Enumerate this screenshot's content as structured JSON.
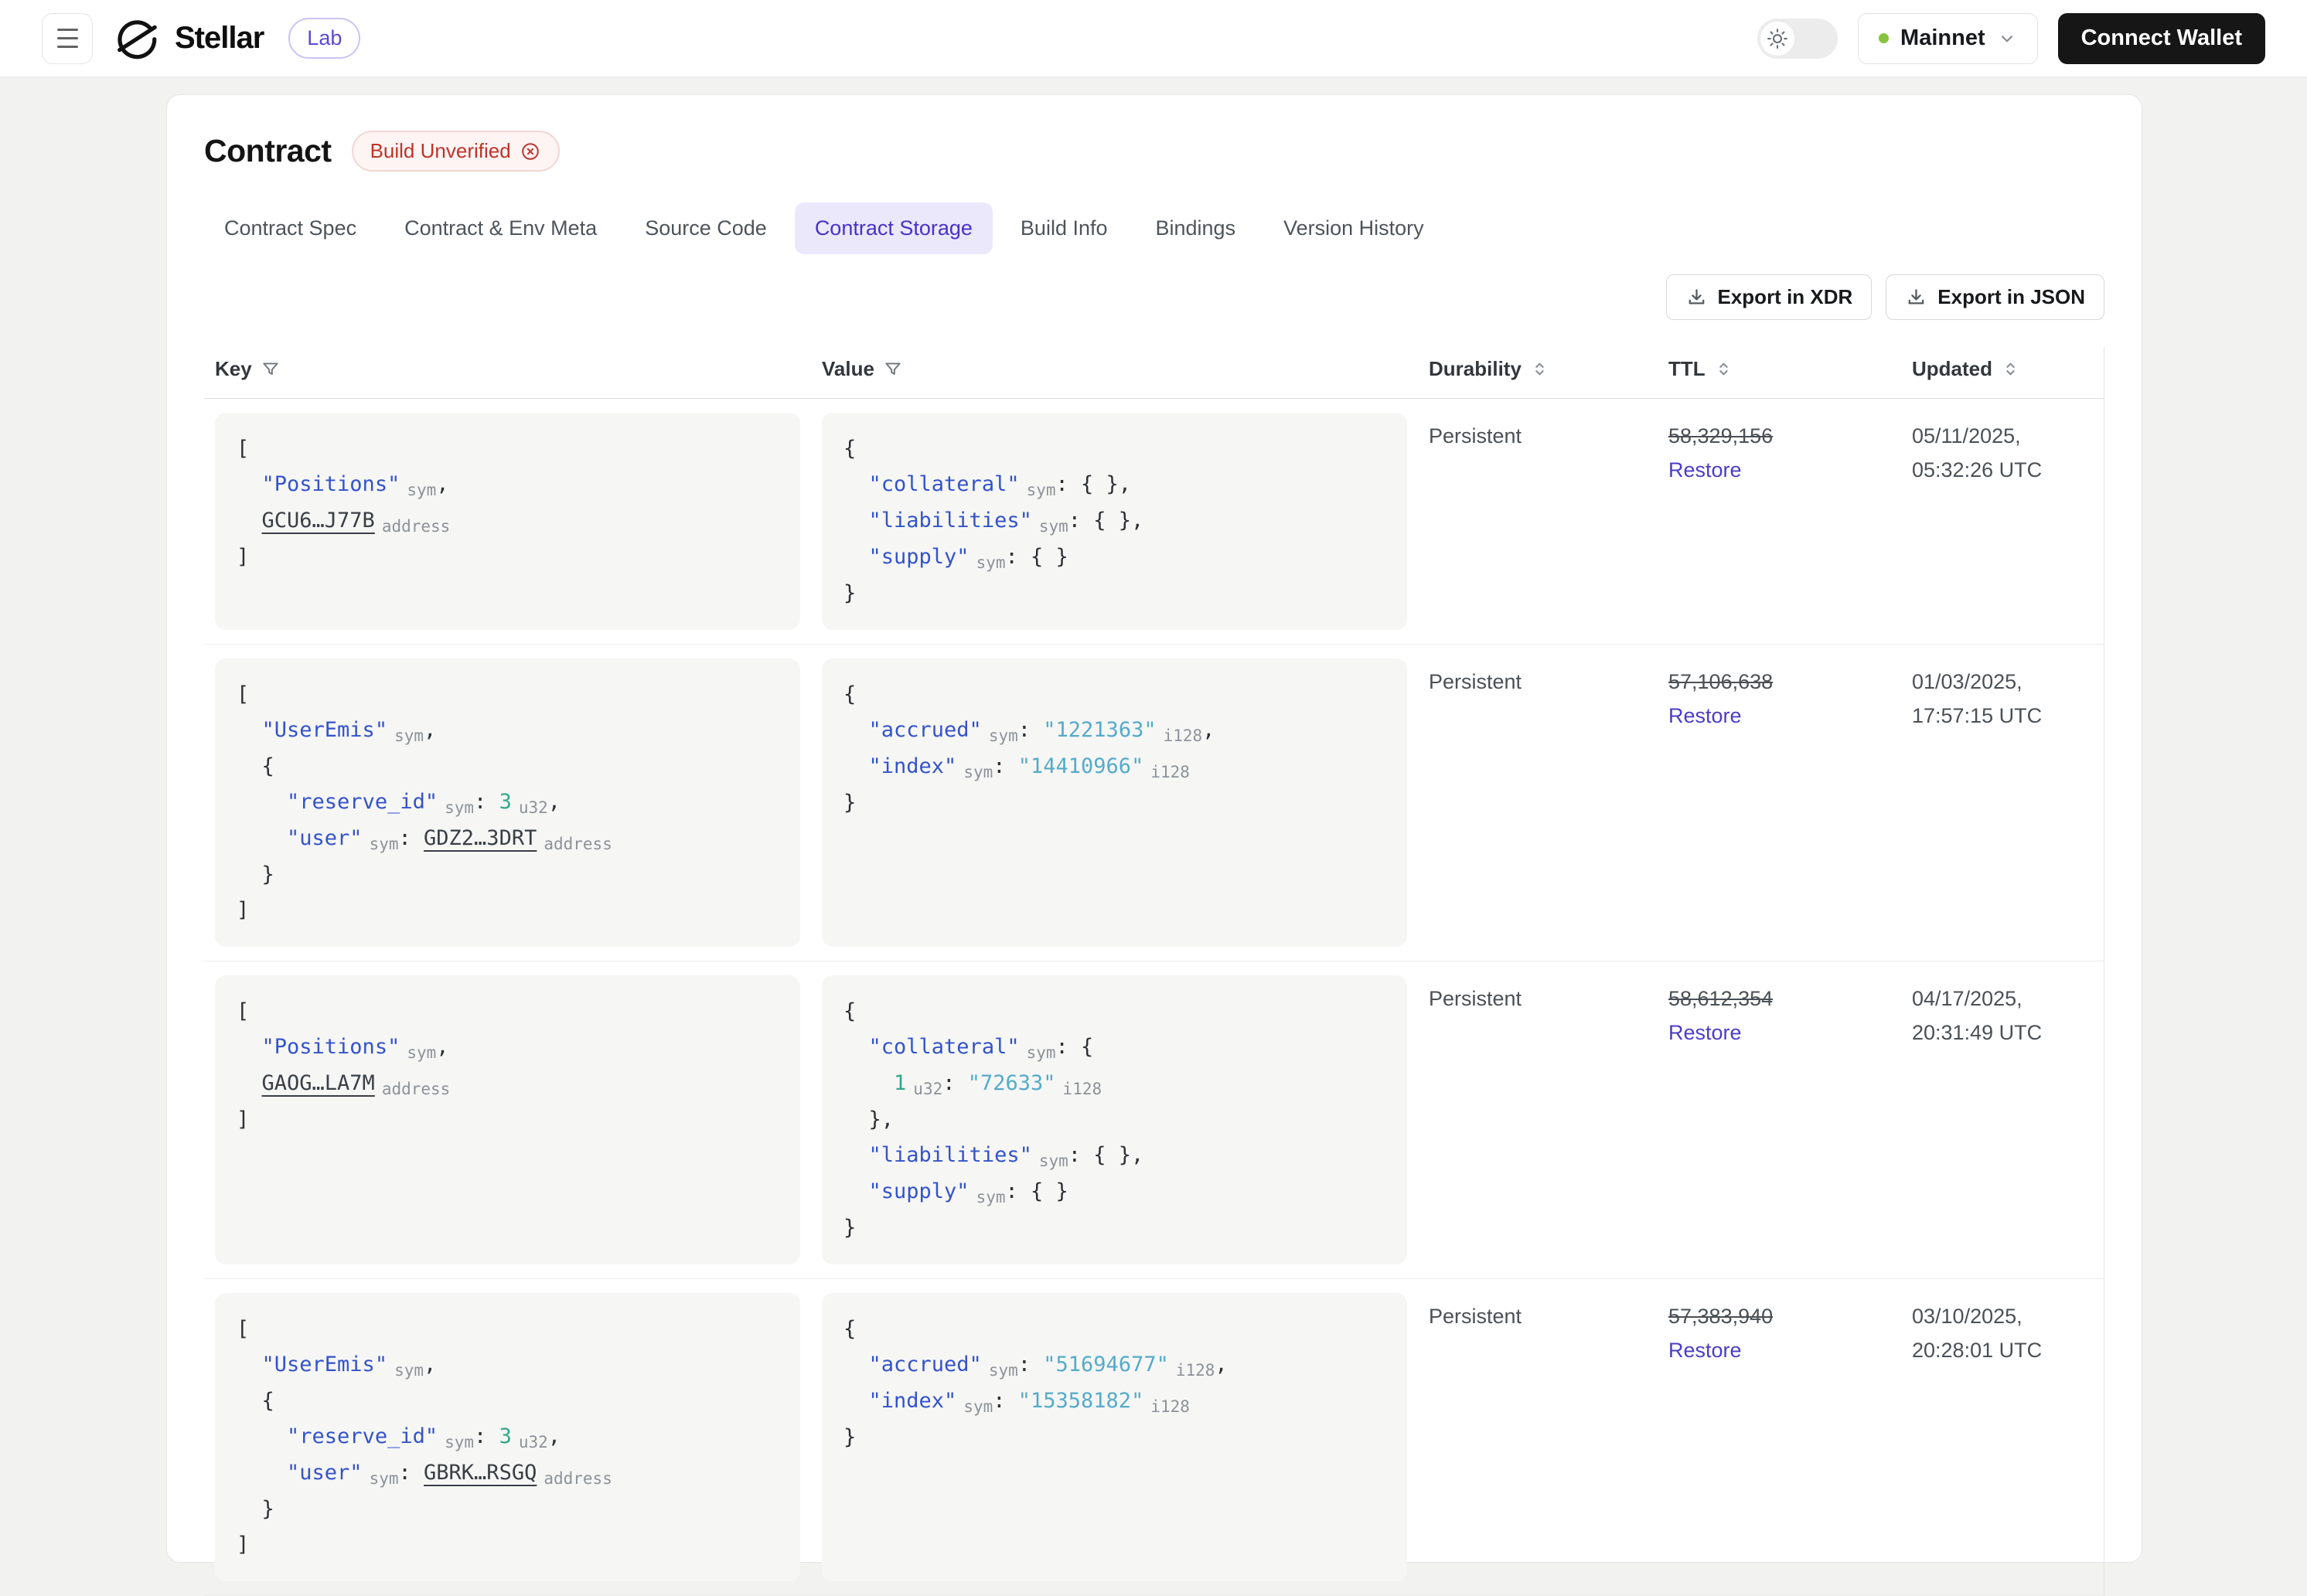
{
  "header": {
    "brand": "Stellar",
    "badge": "Lab",
    "network": "Mainnet",
    "connect_wallet": "Connect Wallet",
    "icons": [
      "menu-icon",
      "stellar-logo-icon",
      "sun-icon",
      "chevron-down-icon"
    ]
  },
  "page": {
    "title": "Contract",
    "status_badge": "Build Unverified",
    "tabs": [
      {
        "label": "Contract Spec",
        "active": false
      },
      {
        "label": "Contract & Env Meta",
        "active": false
      },
      {
        "label": "Source Code",
        "active": false
      },
      {
        "label": "Contract Storage",
        "active": true
      },
      {
        "label": "Build Info",
        "active": false
      },
      {
        "label": "Bindings",
        "active": false
      },
      {
        "label": "Version History",
        "active": false
      }
    ],
    "export_buttons": [
      "Export in XDR",
      "Export in JSON"
    ]
  },
  "table": {
    "columns": [
      {
        "label": "Key",
        "icon": "filter"
      },
      {
        "label": "Value",
        "icon": "filter"
      },
      {
        "label": "Durability",
        "icon": "sort"
      },
      {
        "label": "TTL",
        "icon": "sort"
      },
      {
        "label": "Updated",
        "icon": "sort"
      }
    ],
    "rows": [
      {
        "key": [
          [
            [
              "p",
              "["
            ]
          ],
          [
            [
              "p",
              "  "
            ],
            [
              "k",
              "\"Positions\""
            ],
            [
              "l",
              "sym"
            ],
            [
              "p",
              ","
            ]
          ],
          [
            [
              "p",
              "  "
            ],
            [
              "a",
              "GCU6…J77B"
            ],
            [
              "l",
              "address"
            ]
          ],
          [
            [
              "p",
              "]"
            ]
          ]
        ],
        "value": [
          [
            [
              "p",
              "{"
            ]
          ],
          [
            [
              "p",
              "  "
            ],
            [
              "k",
              "\"collateral\""
            ],
            [
              "l",
              "sym"
            ],
            [
              "p",
              ": { },"
            ]
          ],
          [
            [
              "p",
              "  "
            ],
            [
              "k",
              "\"liabilities\""
            ],
            [
              "l",
              "sym"
            ],
            [
              "p",
              ": { },"
            ]
          ],
          [
            [
              "p",
              "  "
            ],
            [
              "k",
              "\"supply\""
            ],
            [
              "l",
              "sym"
            ],
            [
              "p",
              ": { }"
            ]
          ],
          [
            [
              "p",
              "}"
            ]
          ]
        ],
        "durability": "Persistent",
        "ttl": "58,329,156",
        "restore": "Restore",
        "updated": [
          "05/11/2025,",
          "05:32:26 UTC"
        ]
      },
      {
        "key": [
          [
            [
              "p",
              "["
            ]
          ],
          [
            [
              "p",
              "  "
            ],
            [
              "k",
              "\"UserEmis\""
            ],
            [
              "l",
              "sym"
            ],
            [
              "p",
              ","
            ]
          ],
          [
            [
              "p",
              "  {"
            ]
          ],
          [
            [
              "p",
              "    "
            ],
            [
              "k",
              "\"reserve_id\""
            ],
            [
              "l",
              "sym"
            ],
            [
              "p",
              ": "
            ],
            [
              "n",
              "3"
            ],
            [
              "l",
              "u32"
            ],
            [
              "p",
              ","
            ]
          ],
          [
            [
              "p",
              "    "
            ],
            [
              "k",
              "\"user\""
            ],
            [
              "l",
              "sym"
            ],
            [
              "p",
              ": "
            ],
            [
              "a",
              "GDZ2…3DRT"
            ],
            [
              "l",
              "address"
            ]
          ],
          [
            [
              "p",
              "  }"
            ]
          ],
          [
            [
              "p",
              "]"
            ]
          ]
        ],
        "value": [
          [
            [
              "p",
              "{"
            ]
          ],
          [
            [
              "p",
              "  "
            ],
            [
              "k",
              "\"accrued\""
            ],
            [
              "l",
              "sym"
            ],
            [
              "p",
              ": "
            ],
            [
              "s",
              "\"1221363\""
            ],
            [
              "l",
              "i128"
            ],
            [
              "p",
              ","
            ]
          ],
          [
            [
              "p",
              "  "
            ],
            [
              "k",
              "\"index\""
            ],
            [
              "l",
              "sym"
            ],
            [
              "p",
              ": "
            ],
            [
              "s",
              "\"14410966\""
            ],
            [
              "l",
              "i128"
            ]
          ],
          [
            [
              "p",
              "}"
            ]
          ]
        ],
        "durability": "Persistent",
        "ttl": "57,106,638",
        "restore": "Restore",
        "updated": [
          "01/03/2025,",
          "17:57:15 UTC"
        ]
      },
      {
        "key": [
          [
            [
              "p",
              "["
            ]
          ],
          [
            [
              "p",
              "  "
            ],
            [
              "k",
              "\"Positions\""
            ],
            [
              "l",
              "sym"
            ],
            [
              "p",
              ","
            ]
          ],
          [
            [
              "p",
              "  "
            ],
            [
              "a",
              "GAOG…LA7M"
            ],
            [
              "l",
              "address"
            ]
          ],
          [
            [
              "p",
              "]"
            ]
          ]
        ],
        "value": [
          [
            [
              "p",
              "{"
            ]
          ],
          [
            [
              "p",
              "  "
            ],
            [
              "k",
              "\"collateral\""
            ],
            [
              "l",
              "sym"
            ],
            [
              "p",
              ": {"
            ]
          ],
          [
            [
              "p",
              "    "
            ],
            [
              "n",
              "1"
            ],
            [
              "l",
              "u32"
            ],
            [
              "p",
              ": "
            ],
            [
              "s",
              "\"72633\""
            ],
            [
              "l",
              "i128"
            ]
          ],
          [
            [
              "p",
              "  },"
            ]
          ],
          [
            [
              "p",
              "  "
            ],
            [
              "k",
              "\"liabilities\""
            ],
            [
              "l",
              "sym"
            ],
            [
              "p",
              ": { },"
            ]
          ],
          [
            [
              "p",
              "  "
            ],
            [
              "k",
              "\"supply\""
            ],
            [
              "l",
              "sym"
            ],
            [
              "p",
              ": { }"
            ]
          ],
          [
            [
              "p",
              "}"
            ]
          ]
        ],
        "durability": "Persistent",
        "ttl": "58,612,354",
        "restore": "Restore",
        "updated": [
          "04/17/2025,",
          "20:31:49 UTC"
        ]
      },
      {
        "key": [
          [
            [
              "p",
              "["
            ]
          ],
          [
            [
              "p",
              "  "
            ],
            [
              "k",
              "\"UserEmis\""
            ],
            [
              "l",
              "sym"
            ],
            [
              "p",
              ","
            ]
          ],
          [
            [
              "p",
              "  {"
            ]
          ],
          [
            [
              "p",
              "    "
            ],
            [
              "k",
              "\"reserve_id\""
            ],
            [
              "l",
              "sym"
            ],
            [
              "p",
              ": "
            ],
            [
              "n",
              "3"
            ],
            [
              "l",
              "u32"
            ],
            [
              "p",
              ","
            ]
          ],
          [
            [
              "p",
              "    "
            ],
            [
              "k",
              "\"user\""
            ],
            [
              "l",
              "sym"
            ],
            [
              "p",
              ": "
            ],
            [
              "a",
              "GBRK…RSGQ"
            ],
            [
              "l",
              "address"
            ]
          ],
          [
            [
              "p",
              "  }"
            ]
          ],
          [
            [
              "p",
              "]"
            ]
          ]
        ],
        "value": [
          [
            [
              "p",
              "{"
            ]
          ],
          [
            [
              "p",
              "  "
            ],
            [
              "k",
              "\"accrued\""
            ],
            [
              "l",
              "sym"
            ],
            [
              "p",
              ": "
            ],
            [
              "s",
              "\"51694677\""
            ],
            [
              "l",
              "i128"
            ],
            [
              "p",
              ","
            ]
          ],
          [
            [
              "p",
              "  "
            ],
            [
              "k",
              "\"index\""
            ],
            [
              "l",
              "sym"
            ],
            [
              "p",
              ": "
            ],
            [
              "s",
              "\"15358182\""
            ],
            [
              "l",
              "i128"
            ]
          ],
          [
            [
              "p",
              "}"
            ]
          ]
        ],
        "durability": "Persistent",
        "ttl": "57,383,940",
        "restore": "Restore",
        "updated": [
          "03/10/2025,",
          "20:28:01 UTC"
        ]
      }
    ]
  },
  "colors": {
    "accent_purple": "#4732c8",
    "tab_active_bg": "#ece8fc",
    "restore_link": "#4b3dc9",
    "badge_red": "#bf332a",
    "badge_red_bg": "#fdf4f3",
    "network_dot_green": "#84c43c",
    "code_key_blue": "#3353cb",
    "code_number_teal": "#34a88a",
    "code_string_cyan": "#55abc9",
    "code_label_gray": "#8d9298",
    "connect_wallet_bg": "#161616"
  }
}
